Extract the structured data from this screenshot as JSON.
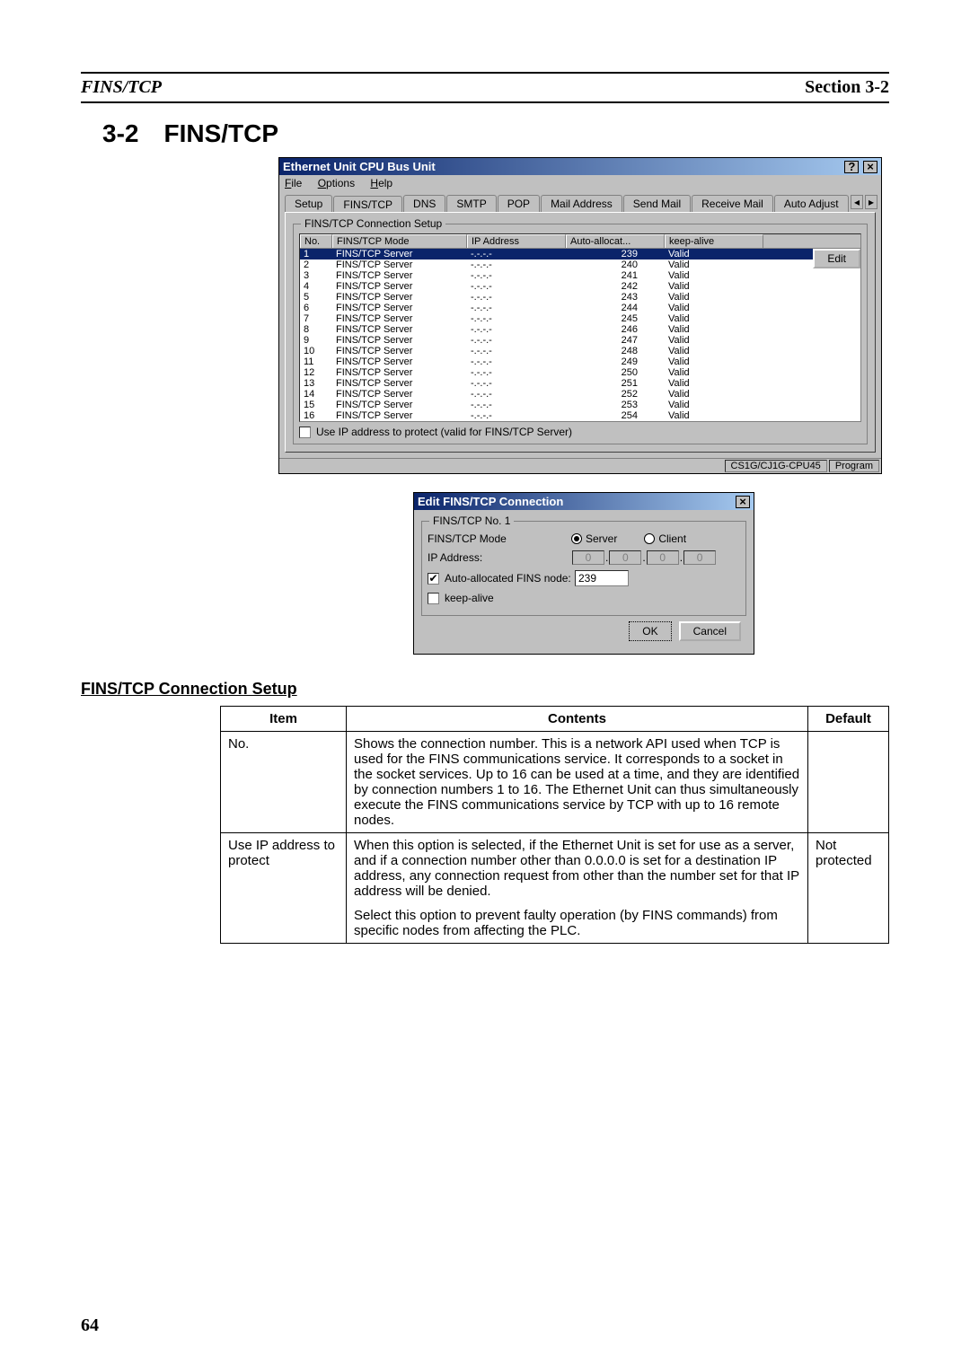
{
  "header": {
    "left": "FINS/TCP",
    "right": "Section 3-2"
  },
  "section_heading": "3-2 FINS/TCP",
  "dialog1": {
    "title": "Ethernet Unit CPU Bus Unit",
    "menu": {
      "file": "File",
      "options": "Options",
      "help": "Help"
    },
    "tabs": [
      "Setup",
      "FINS/TCP",
      "DNS",
      "SMTP",
      "POP",
      "Mail Address",
      "Send Mail",
      "Receive Mail",
      "Auto Adjust"
    ],
    "group_legend": "FINS/TCP Connection Setup",
    "columns": {
      "no": "No.",
      "mode": "FINS/TCP Mode",
      "ip": "IP Address",
      "auto": "Auto-allocat...",
      "keep": "keep-alive"
    },
    "rows": [
      {
        "no": "1",
        "mode": "FINS/TCP Server",
        "ip": "-.-.-.-",
        "auto": "239",
        "keep": "Valid"
      },
      {
        "no": "2",
        "mode": "FINS/TCP Server",
        "ip": "-.-.-.-",
        "auto": "240",
        "keep": "Valid"
      },
      {
        "no": "3",
        "mode": "FINS/TCP Server",
        "ip": "-.-.-.-",
        "auto": "241",
        "keep": "Valid"
      },
      {
        "no": "4",
        "mode": "FINS/TCP Server",
        "ip": "-.-.-.-",
        "auto": "242",
        "keep": "Valid"
      },
      {
        "no": "5",
        "mode": "FINS/TCP Server",
        "ip": "-.-.-.-",
        "auto": "243",
        "keep": "Valid"
      },
      {
        "no": "6",
        "mode": "FINS/TCP Server",
        "ip": "-.-.-.-",
        "auto": "244",
        "keep": "Valid"
      },
      {
        "no": "7",
        "mode": "FINS/TCP Server",
        "ip": "-.-.-.-",
        "auto": "245",
        "keep": "Valid"
      },
      {
        "no": "8",
        "mode": "FINS/TCP Server",
        "ip": "-.-.-.-",
        "auto": "246",
        "keep": "Valid"
      },
      {
        "no": "9",
        "mode": "FINS/TCP Server",
        "ip": "-.-.-.-",
        "auto": "247",
        "keep": "Valid"
      },
      {
        "no": "10",
        "mode": "FINS/TCP Server",
        "ip": "-.-.-.-",
        "auto": "248",
        "keep": "Valid"
      },
      {
        "no": "11",
        "mode": "FINS/TCP Server",
        "ip": "-.-.-.-",
        "auto": "249",
        "keep": "Valid"
      },
      {
        "no": "12",
        "mode": "FINS/TCP Server",
        "ip": "-.-.-.-",
        "auto": "250",
        "keep": "Valid"
      },
      {
        "no": "13",
        "mode": "FINS/TCP Server",
        "ip": "-.-.-.-",
        "auto": "251",
        "keep": "Valid"
      },
      {
        "no": "14",
        "mode": "FINS/TCP Server",
        "ip": "-.-.-.-",
        "auto": "252",
        "keep": "Valid"
      },
      {
        "no": "15",
        "mode": "FINS/TCP Server",
        "ip": "-.-.-.-",
        "auto": "253",
        "keep": "Valid"
      },
      {
        "no": "16",
        "mode": "FINS/TCP Server",
        "ip": "-.-.-.-",
        "auto": "254",
        "keep": "Valid"
      }
    ],
    "protect_checkbox": "Use IP address to protect (valid for FINS/TCP Server)",
    "edit_button": "Edit",
    "status": {
      "cpu": "CS1G/CJ1G-CPU45",
      "mode": "Program"
    }
  },
  "dialog2": {
    "title": "Edit FINS/TCP Connection",
    "group_legend": "FINS/TCP No. 1",
    "mode_label": "FINS/TCP Mode",
    "server": "Server",
    "client": "Client",
    "ip_label": "IP Address:",
    "ip": [
      "0",
      "0",
      "0",
      "0"
    ],
    "auto_label": "Auto-allocated FINS node:",
    "auto_value": "239",
    "keep_label": "keep-alive",
    "ok": "OK",
    "cancel": "Cancel"
  },
  "subsection": "FINS/TCP Connection Setup",
  "table": {
    "head": {
      "item": "Item",
      "contents": "Contents",
      "default": "Default"
    },
    "rows": [
      {
        "item": "No.",
        "contents": "Shows the connection number. This is a network API used when TCP is used for the FINS communications service. It corresponds to a socket in the socket services. Up to 16 can be used at a time, and they are identified by connection numbers 1 to 16. The Ethernet Unit can thus simultaneously execute the FINS communications service by TCP with up to 16 remote nodes.",
        "default": ""
      },
      {
        "item": "Use IP address to protect",
        "contents": "When this option is selected, if the Ethernet Unit is set for use as a server, and if a connection number other than 0.0.0.0 is set for a destination IP address, any connection request from other than the number set for that IP address will be denied.",
        "contents2": "Select this option to prevent faulty operation (by FINS commands) from specific nodes from affecting the PLC.",
        "default": "Not protected"
      }
    ]
  },
  "page_number": "64"
}
